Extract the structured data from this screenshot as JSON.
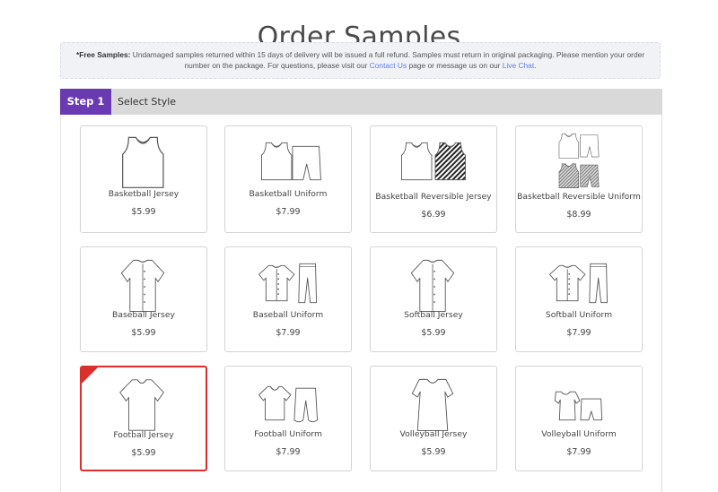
{
  "page": {
    "title": "Order Samples"
  },
  "notice": {
    "bold": "*Free Samples:",
    "text1": " Undamaged samples returned within 15 days of delivery will be issued a full refund. Samples must return in original packaging. Please mention your order number on the package. For questions, please visit our ",
    "link1": "Contact Us",
    "text2": " page or message us on our ",
    "link2": "Live Chat",
    "text3": ".",
    "link_color": "#5b7fe6"
  },
  "step": {
    "badge": "Step 1",
    "label": "Select Style",
    "badge_color": "#6a3ab2"
  },
  "products": [
    {
      "name": "Basketball Jersey",
      "price": "$5.99",
      "icon": "basketball-jersey-icon",
      "selected": false
    },
    {
      "name": "Basketball Uniform",
      "price": "$7.99",
      "icon": "basketball-uniform-icon",
      "selected": false
    },
    {
      "name": "Basketball Reversible Jersey",
      "price": "$6.99",
      "icon": "basketball-reversible-jersey-icon",
      "selected": false
    },
    {
      "name": "Basketball Reversible Uniform",
      "price": "$8.99",
      "icon": "basketball-reversible-uniform-icon",
      "selected": false
    },
    {
      "name": "Baseball Jersey",
      "price": "$5.99",
      "icon": "baseball-jersey-icon",
      "selected": false
    },
    {
      "name": "Baseball Uniform",
      "price": "$7.99",
      "icon": "baseball-uniform-icon",
      "selected": false
    },
    {
      "name": "Softball Jersey",
      "price": "$5.99",
      "icon": "softball-jersey-icon",
      "selected": false
    },
    {
      "name": "Softball Uniform",
      "price": "$7.99",
      "icon": "softball-uniform-icon",
      "selected": false
    },
    {
      "name": "Football Jersey",
      "price": "$5.99",
      "icon": "football-jersey-icon",
      "selected": true
    },
    {
      "name": "Football Uniform",
      "price": "$7.99",
      "icon": "football-uniform-icon",
      "selected": false
    },
    {
      "name": "Volleyball Jersey",
      "price": "$5.99",
      "icon": "volleyball-jersey-icon",
      "selected": false
    },
    {
      "name": "Volleyball Uniform",
      "price": "$7.99",
      "icon": "volleyball-uniform-icon",
      "selected": false
    }
  ],
  "colors": {
    "selected_border": "#d9302c"
  }
}
